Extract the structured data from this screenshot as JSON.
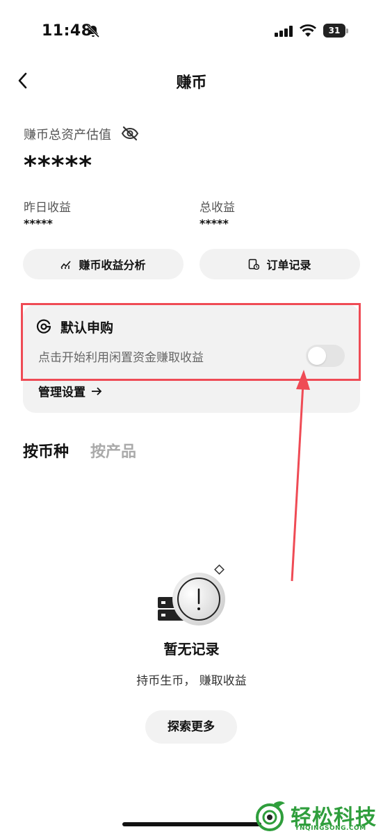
{
  "status_bar": {
    "time": "11:48",
    "battery_level": "31"
  },
  "nav": {
    "title": "赚币"
  },
  "assets": {
    "total_label": "赚币总资产估值",
    "total_value": "*****",
    "yesterday_label": "昨日收益",
    "yesterday_value": "*****",
    "cumulative_label": "总收益",
    "cumulative_value": "*****"
  },
  "actions": {
    "analysis_label": "赚币收益分析",
    "orders_label": "订单记录"
  },
  "auto_subscribe": {
    "title": "默认申购",
    "description": "点击开始利用闲置资金赚取收益",
    "toggle_on": false,
    "manage_label": "管理设置"
  },
  "tabs": [
    {
      "label": "按币种",
      "active": true
    },
    {
      "label": "按产品",
      "active": false
    }
  ],
  "empty_state": {
    "title": "暂无记录",
    "subtitle": "持币生币， 赚取收益",
    "button_label": "探索更多"
  },
  "watermark": {
    "cn": "轻松科技",
    "en": "YNQINGSONG.COM"
  },
  "colors": {
    "highlight": "#ef4b55",
    "watermark": "#2f9e3c",
    "card_bg": "#f2f2f2"
  }
}
